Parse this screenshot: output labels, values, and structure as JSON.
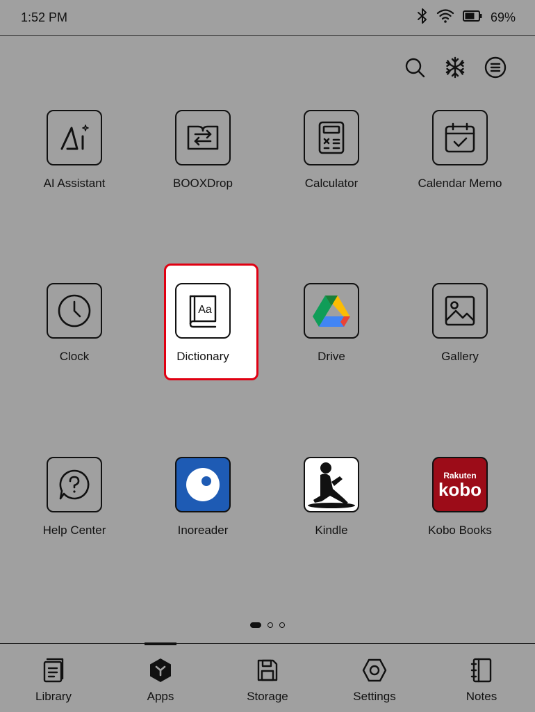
{
  "status": {
    "time": "1:52 PM",
    "battery": "69%"
  },
  "top_actions": [
    "search-icon",
    "freeze-icon",
    "menu-icon"
  ],
  "apps": [
    {
      "label": "AI Assistant",
      "icon": "ai-assistant-icon"
    },
    {
      "label": "BOOXDrop",
      "icon": "booxdrop-icon"
    },
    {
      "label": "Calculator",
      "icon": "calculator-icon"
    },
    {
      "label": "Calendar Memo",
      "icon": "calendar-icon"
    },
    {
      "label": "Clock",
      "icon": "clock-icon"
    },
    {
      "label": "Dictionary",
      "icon": "dictionary-icon",
      "selected": true,
      "glyph": "Aa"
    },
    {
      "label": "Drive",
      "icon": "drive-icon"
    },
    {
      "label": "Gallery",
      "icon": "gallery-icon"
    },
    {
      "label": "Help Center",
      "icon": "help-icon"
    },
    {
      "label": "Inoreader",
      "icon": "inoreader-icon"
    },
    {
      "label": "Kindle",
      "icon": "kindle-icon"
    },
    {
      "label": "Kobo Books",
      "icon": "kobo-icon",
      "logo_top": "Rakuten",
      "logo_bottom": "kobo"
    }
  ],
  "pager": {
    "pages": 3,
    "current": 1
  },
  "nav": [
    {
      "label": "Library",
      "icon": "library-icon"
    },
    {
      "label": "Apps",
      "icon": "apps-icon",
      "active": true
    },
    {
      "label": "Storage",
      "icon": "storage-icon"
    },
    {
      "label": "Settings",
      "icon": "settings-icon"
    },
    {
      "label": "Notes",
      "icon": "notes-icon"
    }
  ],
  "colors": {
    "background": "#a0a0a0",
    "highlight": "#e00012",
    "inoreader": "#1e5bb4",
    "kobo": "#9c0c18"
  }
}
